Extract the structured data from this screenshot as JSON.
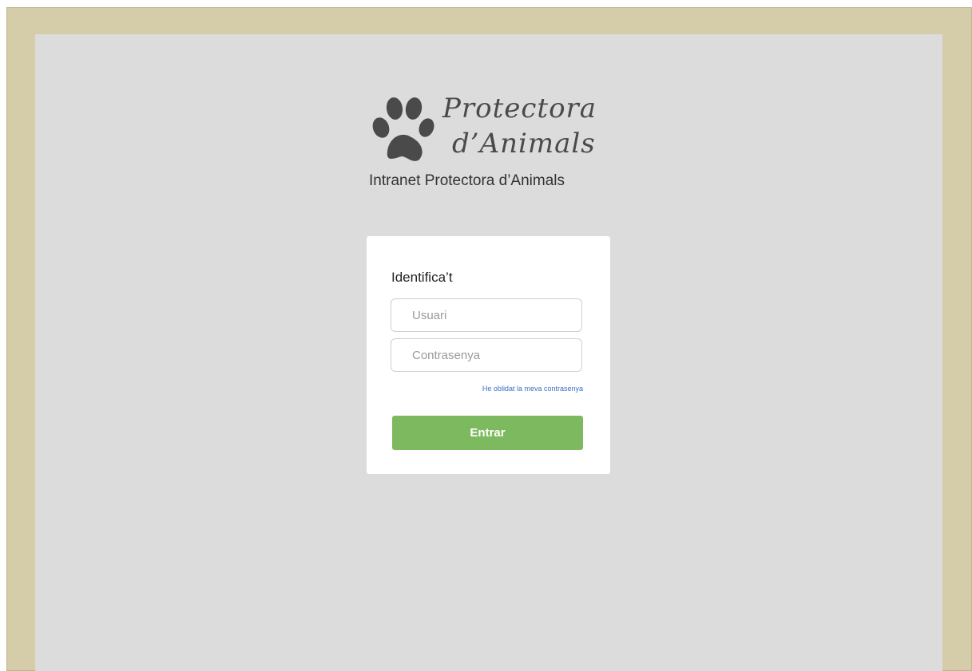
{
  "logo": {
    "line1": "Protectora",
    "line2": "d’Animals",
    "subtitle": "Intranet Protectora d’Animals",
    "icon": "paw-print-icon"
  },
  "login": {
    "title": "Identifica’t",
    "username_placeholder": "Usuari",
    "username_value": "",
    "password_placeholder": "Contrasenya",
    "password_value": "",
    "forgot_label": "He oblidat la meva contrasenya",
    "submit_label": "Entrar"
  },
  "colors": {
    "frame": "#d5ccaa",
    "page_background": "#dcdcdc",
    "card": "#ffffff",
    "button": "#7dba5f",
    "link": "#3a6fc4"
  }
}
